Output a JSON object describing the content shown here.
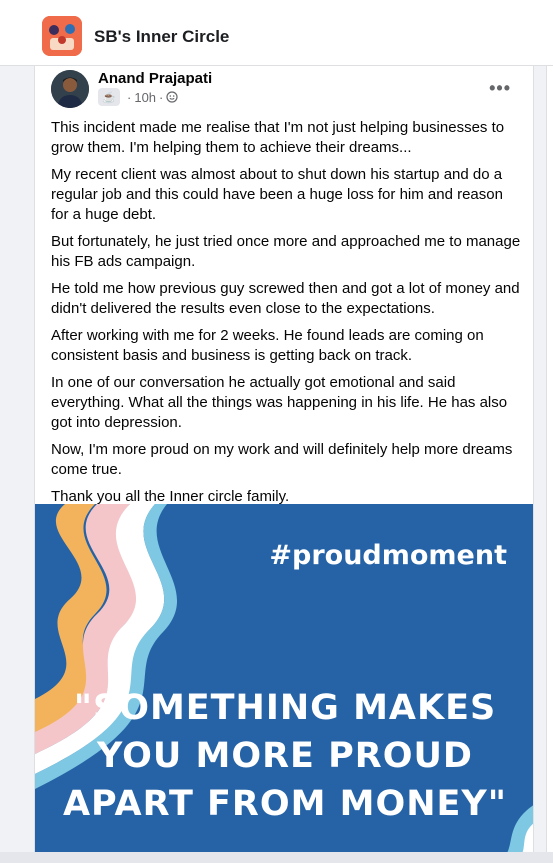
{
  "group": {
    "name": "SB's Inner Circle"
  },
  "post": {
    "author": "Anand Prajapati",
    "badge_icon": "coffee-badge-icon",
    "time": "10h",
    "dot": "·",
    "more_label": "•••",
    "paragraphs": [
      "This incident made me realise that I'm not just helping businesses to grow them. I'm helping them to achieve their dreams...",
      "My recent client was almost about to shut down his startup and do a regular job and this could have been a huge loss for him and reason for a huge debt.",
      "But fortunately, he just tried once more and approached me to manage his FB ads campaign.",
      "He told me how previous guy screwed then and got a lot of money and didn't delivered the results even close to the expectations.",
      "After working with me for 2 weeks. He found leads are coming on consistent basis and business is getting back on track.",
      "In one of our conversation he actually got emotional and said everything. What all the things was happening in his life. He has also got into depression.",
      "Now, I'm more proud on my work and will definitely help more dreams come true.",
      "Thank you all the Inner circle family."
    ],
    "image": {
      "hashtag": "#proudmoment",
      "quote_line1": "\"SOMETHING MAKES",
      "quote_line2": "YOU MORE PROUD",
      "quote_line3": "APART FROM MONEY\""
    }
  },
  "colors": {
    "banner_bg": "#2563a6",
    "wave_orange": "#f3b35d",
    "wave_pink": "#f4c6c9",
    "wave_white": "#ffffff",
    "wave_teal": "#7ec8e3"
  }
}
